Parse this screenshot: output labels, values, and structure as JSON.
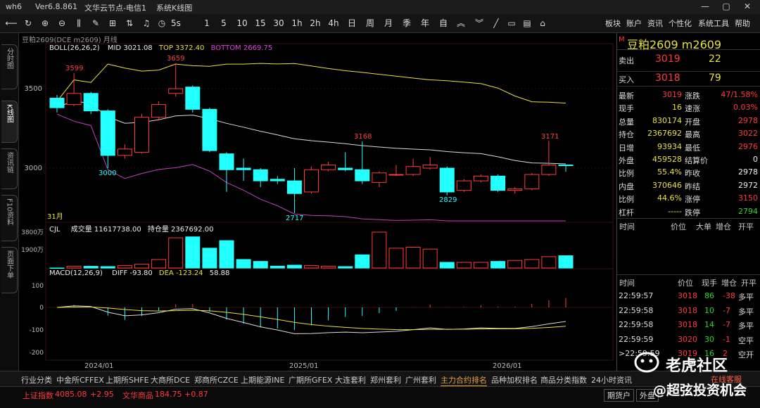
{
  "titlebar": {
    "app": "wh6",
    "version": "Ver6.8.861",
    "node": "文华云节点-电信1",
    "mode": "系统K线图"
  },
  "window_buttons": [
    "—",
    "▢",
    "✕"
  ],
  "toolbar": {
    "periods": [
      "5s",
      "1",
      "5",
      "10",
      "15",
      "30",
      "1h",
      "2h",
      "4h",
      "日",
      "周",
      "月",
      "季",
      "年",
      "自"
    ],
    "right_menu": [
      "板块",
      "账户",
      "资讯",
      "个性化",
      "系统工具",
      "帮助"
    ]
  },
  "sidebar": [
    "分时图",
    "K线图",
    "资讯链",
    "F10资料",
    "页面下单"
  ],
  "chart": {
    "header": "豆粕2609(DCE m2609)  月线",
    "boll_label": "BOLL(26,26,2)",
    "mid": "MID 3021.08",
    "top": "TOP 3372.40",
    "bottom": "BOTTOM 2669.75",
    "annotations": {
      "high1": "3599",
      "high2": "3659",
      "low1": "3000",
      "mid_high": "3168",
      "low2": "2717",
      "low3": "2829",
      "high3": "3171",
      "month": "31月"
    },
    "y_labels": {
      "p3500": "3500",
      "p3000": "3000"
    },
    "vol_label": "CJL",
    "vol_value": "成交量 11617738.00",
    "oi_value": "持仓量 2367692.00",
    "vol_y": {
      "hi": "3800万",
      "mid": "1900万"
    },
    "macd_label": "MACD(12,26,9)",
    "diff": "DIFF -93.80",
    "dea": "DEA -123.24",
    "macd": "58.88",
    "macd_y": [
      "100",
      "0",
      "-100",
      "-200"
    ],
    "x_labels": [
      "2024/01",
      "2025/01",
      "2026/01"
    ]
  },
  "chart_data": {
    "type": "candlestick",
    "instrument": "豆粕2609",
    "candles": [
      {
        "o": 3440,
        "c": 3380,
        "h": 3460,
        "l": 3350
      },
      {
        "o": 3400,
        "c": 3470,
        "h": 3599,
        "l": 3390
      },
      {
        "o": 3470,
        "c": 3360,
        "h": 3480,
        "l": 3340
      },
      {
        "o": 3360,
        "c": 3080,
        "h": 3370,
        "l": 3000
      },
      {
        "o": 3080,
        "c": 3120,
        "h": 3150,
        "l": 3060
      },
      {
        "o": 3100,
        "c": 3320,
        "h": 3340,
        "l": 3090
      },
      {
        "o": 3320,
        "c": 3400,
        "h": 3420,
        "l": 3300
      },
      {
        "o": 3470,
        "c": 3500,
        "h": 3659,
        "l": 3450
      },
      {
        "o": 3510,
        "c": 3370,
        "h": 3520,
        "l": 3350
      },
      {
        "o": 3370,
        "c": 3110,
        "h": 3380,
        "l": 3100
      },
      {
        "o": 3090,
        "c": 2990,
        "h": 3100,
        "l": 2850
      },
      {
        "o": 3000,
        "c": 2990,
        "h": 3060,
        "l": 2920
      },
      {
        "o": 2990,
        "c": 2920,
        "h": 3000,
        "l": 2880
      },
      {
        "o": 2930,
        "c": 2920,
        "h": 2950,
        "l": 2900
      },
      {
        "o": 2920,
        "c": 2840,
        "h": 3000,
        "l": 2717
      },
      {
        "o": 2850,
        "c": 2990,
        "h": 3010,
        "l": 2840
      },
      {
        "o": 2990,
        "c": 3020,
        "h": 3040,
        "l": 2980
      },
      {
        "o": 3000,
        "c": 2990,
        "h": 3100,
        "l": 2980
      },
      {
        "o": 2990,
        "c": 2920,
        "h": 3168,
        "l": 2900
      },
      {
        "o": 2910,
        "c": 2970,
        "h": 2980,
        "l": 2880
      },
      {
        "o": 2960,
        "c": 2960,
        "h": 3020,
        "l": 2950
      },
      {
        "o": 2960,
        "c": 3010,
        "h": 3060,
        "l": 2950
      },
      {
        "o": 3000,
        "c": 3020,
        "h": 3070,
        "l": 2990
      },
      {
        "o": 3000,
        "c": 2850,
        "h": 3010,
        "l": 2829
      },
      {
        "o": 2860,
        "c": 2920,
        "h": 2930,
        "l": 2850
      },
      {
        "o": 2920,
        "c": 2950,
        "h": 2960,
        "l": 2910
      },
      {
        "o": 2950,
        "c": 2860,
        "h": 2960,
        "l": 2850
      },
      {
        "o": 2860,
        "c": 2870,
        "h": 2880,
        "l": 2840
      },
      {
        "o": 2870,
        "c": 2960,
        "h": 2970,
        "l": 2860
      },
      {
        "o": 2960,
        "c": 3020,
        "h": 3171,
        "l": 2950
      },
      {
        "o": 3020,
        "c": 3019,
        "h": 3022,
        "l": 2976
      }
    ],
    "volume": [
      0,
      200,
      180,
      150,
      250,
      400,
      900,
      3200,
      3300,
      2100,
      2900,
      900,
      700,
      200,
      300,
      250,
      200,
      150,
      1400,
      3800,
      2100,
      2200,
      2000,
      600,
      600,
      600,
      700,
      800,
      900,
      1200,
      1300
    ],
    "macd": {
      "diff": -93.8,
      "dea": -123.24,
      "hist": 58.88
    }
  },
  "quote": {
    "title": "豆粕2609  m2609",
    "sell_label": "卖出",
    "sell_price": "3019",
    "sell_vol": "22",
    "buy_label": "买入",
    "buy_price": "3018",
    "buy_vol": "79",
    "rows": [
      [
        "最新",
        "3019",
        "涨跌",
        "47/1.58%"
      ],
      [
        "现手",
        "16",
        "速涨",
        "0.03%"
      ],
      [
        "总量",
        "830174",
        "开盘",
        "2978"
      ],
      [
        "持仓",
        "2367692",
        "最高",
        "3022"
      ],
      [
        "日增",
        "93934",
        "最低",
        "2976"
      ],
      [
        "外盘",
        "459528",
        "结算价",
        "0"
      ],
      [
        "比例",
        "55.4%",
        "昨收",
        "2978"
      ],
      [
        "内盘",
        "370646",
        "昨结",
        "2972"
      ],
      [
        "比例",
        "44.6%",
        "涨停",
        "3150"
      ],
      [
        "杠杆",
        "-----",
        "跌停",
        "2794"
      ]
    ],
    "tick_headers": [
      "时间",
      "价位",
      "大单",
      "增仓",
      "开平"
    ],
    "trade_headers": [
      "时间",
      "价位",
      "现手",
      "增仓",
      "开平"
    ],
    "trades": [
      [
        "22:59:57",
        "3018",
        "86",
        "-38",
        "多平"
      ],
      [
        "22:59:58",
        "3018",
        "10",
        "-7",
        "多平"
      ],
      [
        "22:59:58",
        "3018",
        "14",
        "-7",
        "多平"
      ],
      [
        "22:59:59",
        "3020",
        "30",
        "-1",
        "空平"
      ],
      [
        ">22:59:59",
        "3019",
        "16",
        "2",
        "空开"
      ]
    ]
  },
  "bottom_tabs": [
    "行业分类",
    "中金所CFFEX",
    "上期所SHFE",
    "大商所DCE",
    "郑商所CZCE",
    "上期能源INE",
    "广期所GFEX",
    "大连套利",
    "郑州套利",
    "广州套利",
    "主力合约排名",
    "品种加权排名",
    "商品分类指数",
    "24小时资讯"
  ],
  "status": {
    "index1_name": "上证指数",
    "index1_val": "4085.08",
    "index1_chg": "+2.95",
    "index2_name": "文华商品",
    "index2_val": "184.75",
    "index2_chg": "+0.87",
    "btn1": "期货户",
    "btn2": "外盘"
  },
  "watermark": {
    "brand": "老虎社区",
    "handle": "@超弦投资机会",
    "service": "在线客服"
  }
}
